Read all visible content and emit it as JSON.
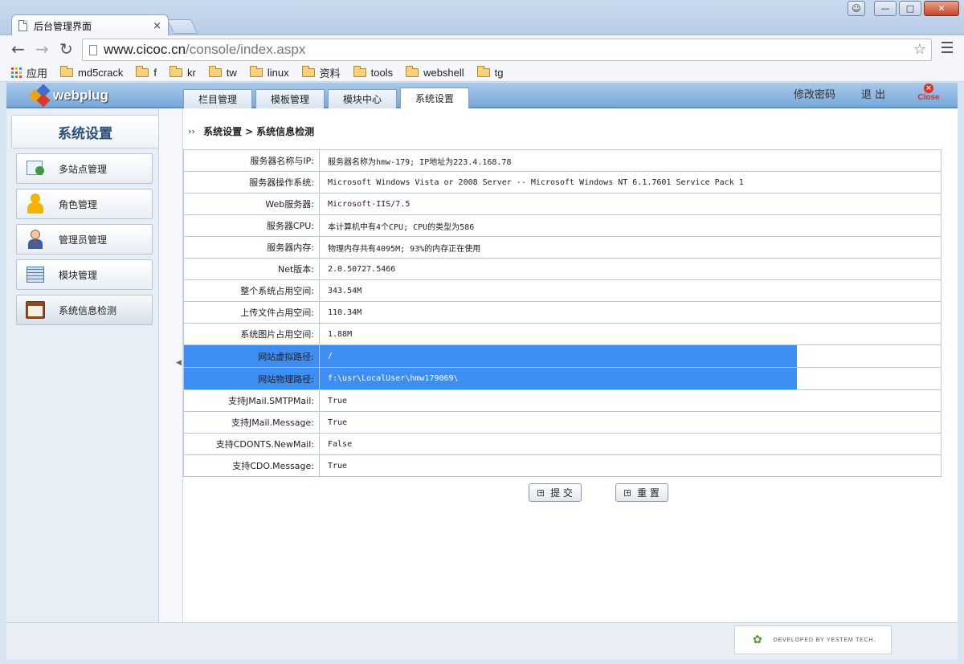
{
  "browser": {
    "tab_title": "后台管理界面",
    "tab_close": "×",
    "url_host": "www.cicoc.cn",
    "url_path": "/console/index.aspx",
    "bookmarks": [
      {
        "label": "应用",
        "icon": "apps-icon"
      },
      {
        "label": "md5crack",
        "icon": "folder-icon"
      },
      {
        "label": "f",
        "icon": "folder-icon"
      },
      {
        "label": "kr",
        "icon": "folder-icon"
      },
      {
        "label": "tw",
        "icon": "folder-icon"
      },
      {
        "label": "linux",
        "icon": "folder-icon"
      },
      {
        "label": "资料",
        "icon": "folder-icon"
      },
      {
        "label": "tools",
        "icon": "folder-icon"
      },
      {
        "label": "webshell",
        "icon": "folder-icon"
      },
      {
        "label": "tg",
        "icon": "folder-icon"
      }
    ]
  },
  "app": {
    "logo_text": "webplug",
    "nav_tabs": [
      {
        "label": "栏目管理",
        "active": false
      },
      {
        "label": "模板管理",
        "active": false
      },
      {
        "label": "模块中心",
        "active": false
      },
      {
        "label": "系统设置",
        "active": true
      }
    ],
    "change_password": "修改密码",
    "logout": "退 出",
    "close_label": "Close"
  },
  "sidebar": {
    "title": "系统设置",
    "items": [
      {
        "label": "多站点管理",
        "icon": "multisite-icon"
      },
      {
        "label": "角色管理",
        "icon": "role-icon"
      },
      {
        "label": "管理员管理",
        "icon": "admin-user-icon"
      },
      {
        "label": "模块管理",
        "icon": "module-grid-icon"
      },
      {
        "label": "系统信息检测",
        "icon": "calendar-icon",
        "active": true
      }
    ]
  },
  "breadcrumb": {
    "section": "系统设置",
    "separator": ">",
    "page": "系统信息检测"
  },
  "info_rows": [
    {
      "label": "服务器名称与IP:",
      "value": "服务器名称为hmw-179; IP地址为223.4.168.78"
    },
    {
      "label": "服务器操作系统:",
      "value": "Microsoft Windows Vista or 2008 Server -- Microsoft Windows NT 6.1.7601 Service Pack 1"
    },
    {
      "label": "Web服务器:",
      "value": "Microsoft-IIS/7.5"
    },
    {
      "label": "服务器CPU:",
      "value": "本计算机中有4个CPU; CPU的类型为586"
    },
    {
      "label": "服务器内存:",
      "value": "物理内存共有4095M; 93%的内存正在使用"
    },
    {
      "label": "Net版本:",
      "value": "2.0.50727.5466"
    },
    {
      "label": "整个系统占用空间:",
      "value": "343.54M"
    },
    {
      "label": "上传文件占用空间:",
      "value": "110.34M"
    },
    {
      "label": "系统图片占用空间:",
      "value": "1.88M"
    },
    {
      "label": "网站虚拟路径:",
      "value": "/"
    },
    {
      "label": "网站物理路径:",
      "value": "f:\\usr\\LocalUser\\hmw179069\\"
    },
    {
      "label": "支持JMail.SMTPMail:",
      "value": "True"
    },
    {
      "label": "支持JMail.Message:",
      "value": "True"
    },
    {
      "label": "支持CDONTS.NewMail:",
      "value": "False"
    },
    {
      "label": "支持CDO.Message:",
      "value": "True"
    }
  ],
  "buttons": {
    "submit": "提 交",
    "reset": "重 置"
  },
  "footer": {
    "text": "DEVELOPED BY YESTEM TECH."
  },
  "colors": {
    "selection": "#3d8ef0",
    "header_blue": "#7aa8d8"
  }
}
